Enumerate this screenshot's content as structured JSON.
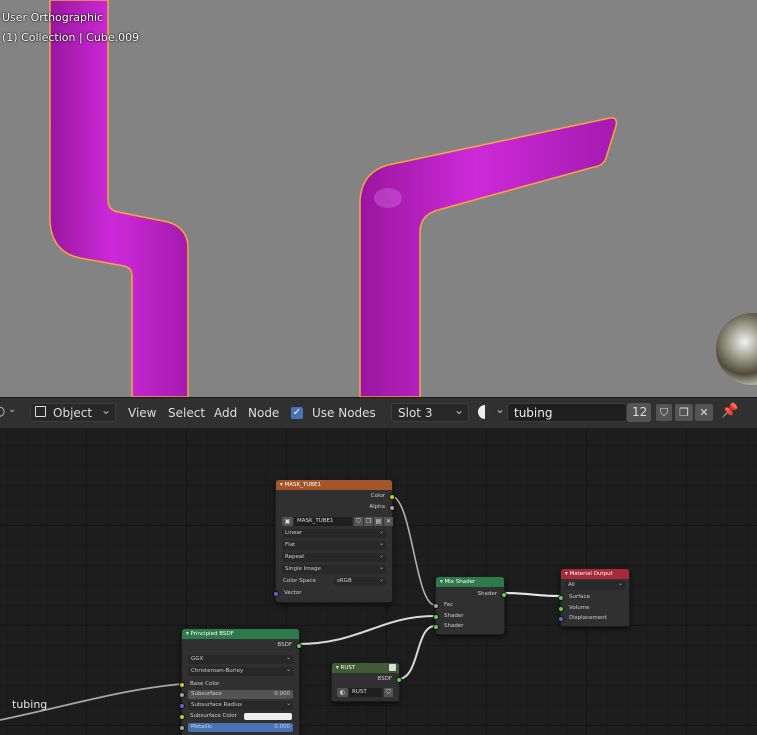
{
  "viewport": {
    "view_label": "User Orthographic",
    "collection_label": "(1) Collection | Cube.009",
    "tube_color": "#c61fd3",
    "outline_color": "#f8a43f",
    "background_color": "#838383"
  },
  "header": {
    "mode_label": "Object",
    "menus": [
      "View",
      "Select",
      "Add",
      "Node"
    ],
    "use_nodes_label": "Use Nodes",
    "use_nodes_checked": true,
    "slot_label": "Slot 3",
    "material_name": "tubing",
    "user_count": "12"
  },
  "nodes": {
    "mask": {
      "title": "MASK_TUBE1",
      "outputs": [
        "Color",
        "Alpha"
      ],
      "image_name": "MASK_TUBE1",
      "interpolation": "Linear",
      "projection": "Flat",
      "extension": "Repeat",
      "source": "Single Image",
      "color_space_label": "Color Space",
      "color_space_value": "sRGB",
      "input": "Vector"
    },
    "mix": {
      "title": "Mix Shader",
      "output": "Shader",
      "inputs": [
        "Fac",
        "Shader",
        "Shader"
      ]
    },
    "output": {
      "title": "Material Output",
      "target": "All",
      "inputs": [
        "Surface",
        "Volume",
        "Displacement"
      ]
    },
    "principled": {
      "title": "Principled BSDF",
      "output": "BSDF",
      "distribution": "GGX",
      "subsurface_method": "Christensen-Burley",
      "base_color_label": "Base Color",
      "subsurface_label": "Subsurface",
      "subsurface_value": "0.000",
      "subsurface_radius_label": "Subsurface Radius",
      "subsurface_color_label": "Subsurface Color",
      "metallic_label": "Metallic",
      "metallic_value": "0.000"
    },
    "rust": {
      "title": "RUST",
      "output": "BSDF",
      "material_name": "RUST"
    }
  },
  "editor": {
    "frame_label": "tubing"
  },
  "colors": {
    "header_orange": "#a6552b",
    "header_green": "#2f7a4b",
    "header_red": "#a82a38",
    "header_darkgreen": "#3f5c36",
    "socket_color": "#c7c729",
    "socket_shader": "#63c763",
    "socket_vector": "#6363c7"
  }
}
